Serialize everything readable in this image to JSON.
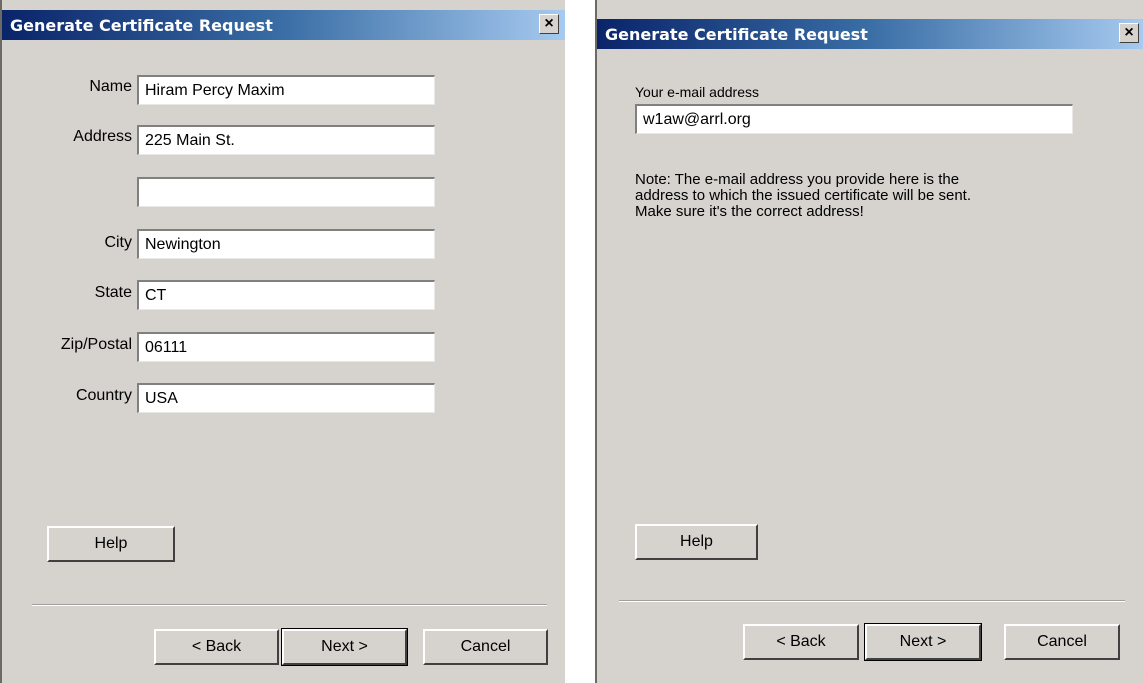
{
  "left_dialog": {
    "title": "Generate Certificate Request",
    "close_glyph": "×",
    "fields": {
      "name": {
        "label": "Name",
        "value": "Hiram Percy Maxim"
      },
      "address1": {
        "label": "Address",
        "value": "225 Main St."
      },
      "address2": {
        "label": "",
        "value": ""
      },
      "city": {
        "label": "City",
        "value": "Newington"
      },
      "state": {
        "label": "State",
        "value": "CT"
      },
      "zip": {
        "label": "Zip/Postal",
        "value": "06111"
      },
      "country": {
        "label": "Country",
        "value": "USA"
      }
    },
    "buttons": {
      "help": "Help",
      "back": "< Back",
      "next": "Next >",
      "cancel": "Cancel"
    }
  },
  "right_dialog": {
    "title": "Generate Certificate Request",
    "close_glyph": "×",
    "email_label": "Your e-mail address",
    "email_value": "w1aw@arrl.org",
    "note_lines": [
      "Note: The e-mail address you provide here is the",
      "address to which the issued certificate will be sent.",
      "Make sure it's the correct address!"
    ],
    "buttons": {
      "help": "Help",
      "back": "< Back",
      "next": "Next >",
      "cancel": "Cancel"
    }
  },
  "colors": {
    "dialog_bg": "#d6d3ce",
    "title_start": "#0a246a",
    "title_end": "#a6caf0"
  }
}
